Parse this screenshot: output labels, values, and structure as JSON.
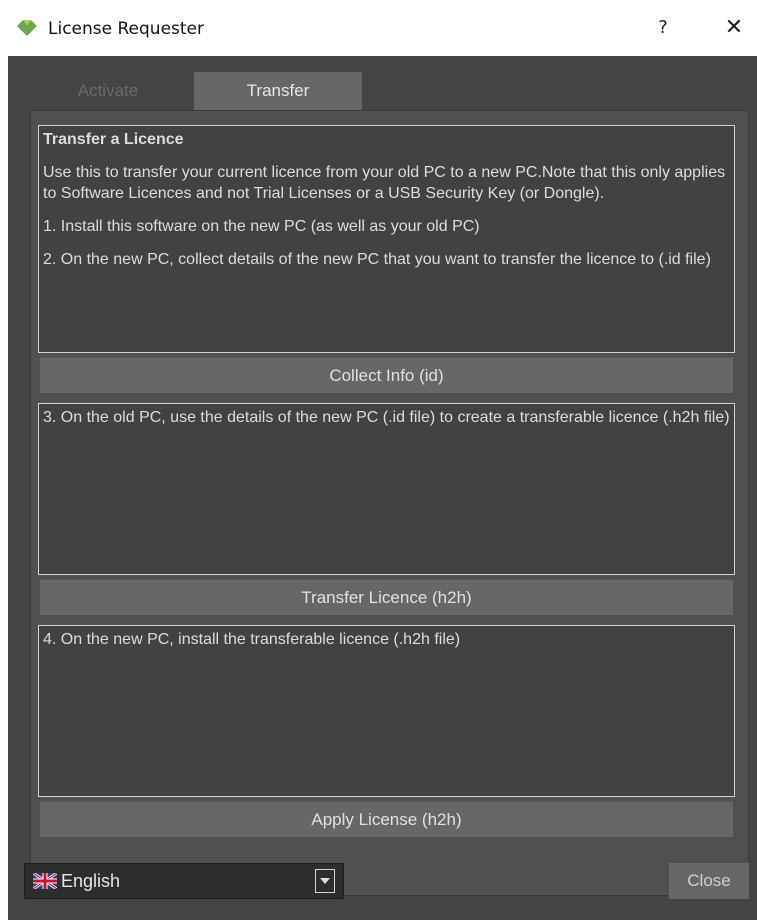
{
  "window": {
    "title": "License Requester",
    "app_icon": "green-diamond-icon",
    "help_label": "?",
    "close_label": "✕"
  },
  "tabs": [
    {
      "label": "Activate",
      "active": false
    },
    {
      "label": "Transfer",
      "active": true
    }
  ],
  "transfer": {
    "box1": {
      "heading": "Transfer a Licence",
      "paragraphs": [
        "Use this to transfer your current licence from your old PC to a new PC.Note that this only applies to Software Licences and not Trial Licenses or a USB Security Key (or Dongle).",
        "1. Install this software on the new PC (as well as your old PC)",
        "2. On the new PC, collect details of the new PC that you want to transfer the licence to (.id file)"
      ]
    },
    "collect_button": "Collect Info (id)",
    "box2_text": "3. On the old PC, use the details of the new PC (.id file) to create a transferable licence (.h2h file)",
    "transfer_button": "Transfer Licence (h2h)",
    "box3_text": "4. On the new PC, install the transferable licence (.h2h file)",
    "apply_button": "Apply License (h2h)"
  },
  "footer": {
    "language_selected": "English",
    "language_flag": "uk-flag-icon",
    "close_button": "Close"
  },
  "colors": {
    "background": "#444444",
    "panel": "#505050",
    "textbox": "#424242",
    "button": "#676767",
    "text": "#dcdcdc",
    "accent_icon": "#6aa84f"
  }
}
